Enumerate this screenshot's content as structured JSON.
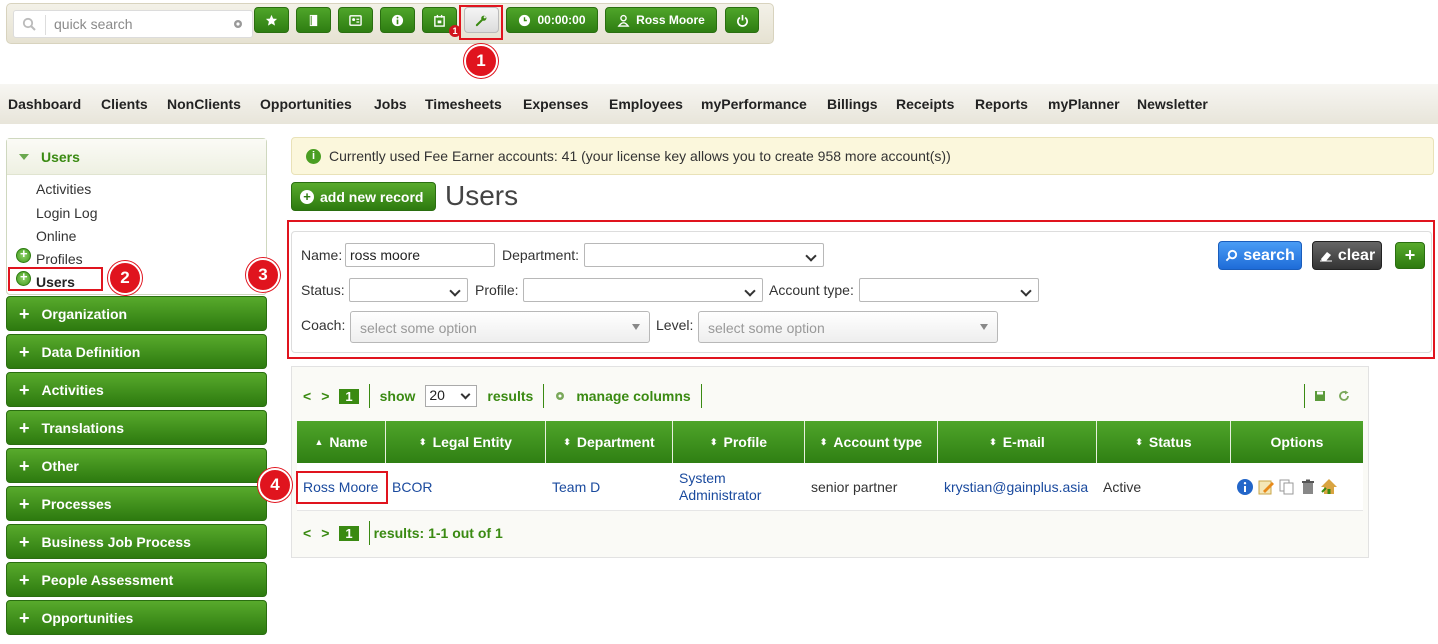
{
  "toolbar": {
    "search_placeholder": "quick search",
    "timer": "00:00:00",
    "user": "Ross Moore",
    "notification_count": "1"
  },
  "annotations": [
    "1",
    "2",
    "3",
    "4"
  ],
  "menu": [
    "Dashboard",
    "Clients",
    "NonClients",
    "Opportunities",
    "Jobs",
    "Timesheets",
    "Expenses",
    "Employees",
    "myPerformance",
    "Billings",
    "Receipts",
    "Reports",
    "myPlanner",
    "Newsletter"
  ],
  "sidebar": {
    "open_section": "Users",
    "items": [
      "Activities",
      "Login Log",
      "Online",
      "Profiles",
      "Users"
    ],
    "sections": [
      "Organization",
      "Data Definition",
      "Activities",
      "Translations",
      "Other",
      "Processes",
      "Business Job Process",
      "People Assessment",
      "Opportunities"
    ]
  },
  "main": {
    "info": "Currently used Fee Earner accounts: 41 (your license key allows you to create 958 more account(s))",
    "add_label": "add new record",
    "title": "Users"
  },
  "filters": {
    "name_label": "Name:",
    "name_value": "ross moore",
    "department_label": "Department:",
    "status_label": "Status:",
    "profile_label": "Profile:",
    "account_type_label": "Account type:",
    "coach_label": "Coach:",
    "coach_placeholder": "select some option",
    "level_label": "Level:",
    "level_placeholder": "select some option",
    "search_label": "search",
    "clear_label": "clear"
  },
  "grid": {
    "page": "1",
    "show_label": "show",
    "page_size": "20",
    "results_label": "results",
    "manage_columns": "manage columns",
    "footer_results": "results: 1-1 out of 1",
    "columns": [
      "Name",
      "Legal Entity",
      "Department",
      "Profile",
      "Account type",
      "E-mail",
      "Status",
      "Options"
    ],
    "rows": [
      {
        "name": "Ross Moore",
        "legal_entity": "BCOR",
        "department": "Team D",
        "profile": "System Administrator",
        "account_type": "senior partner",
        "email": "krystian@gainplus.asia",
        "status": "Active"
      }
    ]
  },
  "colors": {
    "accent_green": "#3a8a12",
    "annotation_red": "#e0141e",
    "search_blue": "#1e6cd8"
  }
}
